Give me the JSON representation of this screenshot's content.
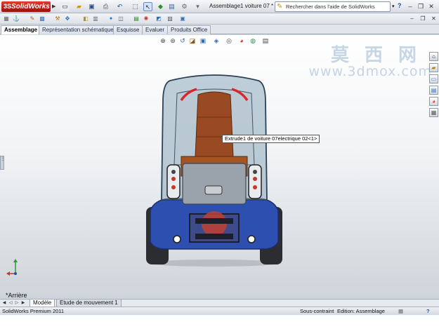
{
  "app": {
    "name": "SolidWorks",
    "document_title": "Assemblage1 voiture 07 *",
    "help_search_placeholder": "Rechercher dans l'aide de SolidWorks"
  },
  "command_tabs": [
    {
      "label": "Assemblage",
      "active": true
    },
    {
      "label": "Représentation schématique",
      "active": false
    },
    {
      "label": "Esquisse",
      "active": false
    },
    {
      "label": "Evaluer",
      "active": false
    },
    {
      "label": "Produits Office",
      "active": false
    }
  ],
  "viewport": {
    "tooltip": "Extrude1 de voiture 07electrique 02<1>",
    "view_orientation": "*Arrière",
    "watermark_cn": "莫西网",
    "watermark_url": "www.3dmox.com"
  },
  "bottom_tabs": [
    {
      "label": "Modèle",
      "active": true
    },
    {
      "label": "Etude de mouvement 1",
      "active": false
    }
  ],
  "status": {
    "version": "SolidWorks Premium 2011",
    "constraint": "Sous-contraint",
    "edit_mode": "Edition: Assemblage"
  },
  "icons": {
    "logo": "solidworks-logo-icon",
    "search": "help-search-icon",
    "help": "help-icon"
  },
  "colors": {
    "logo_red": "#c8261a",
    "seat_brown": "#9a4a22",
    "body_glass": "#7f9fb3",
    "lower_body_blue": "#2d4fb0",
    "brake_red": "#d8262c"
  }
}
